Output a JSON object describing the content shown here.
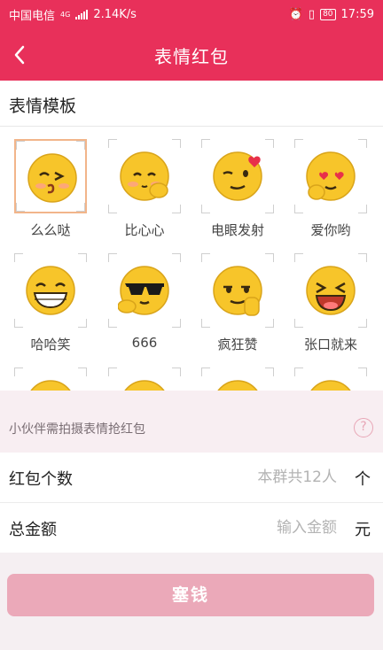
{
  "status_bar": {
    "carrier": "中国电信",
    "network_type": "4G",
    "speed": "2.14K/s",
    "battery": "80",
    "time": "17:59"
  },
  "nav": {
    "title": "表情红包"
  },
  "template_section": {
    "title": "表情模板"
  },
  "stickers": [
    {
      "label": "么么哒",
      "icon": "kissing-face-icon",
      "selected": true
    },
    {
      "label": "比心心",
      "icon": "finger-heart-face-icon",
      "selected": false
    },
    {
      "label": "电眼发射",
      "icon": "winking-face-icon",
      "selected": false
    },
    {
      "label": "爱你哟",
      "icon": "heart-eyes-face-icon",
      "selected": false
    },
    {
      "label": "哈哈笑",
      "icon": "grinning-face-icon",
      "selected": false
    },
    {
      "label": "666",
      "icon": "sunglasses-face-icon",
      "selected": false
    },
    {
      "label": "疯狂赞",
      "icon": "thumbs-up-face-icon",
      "selected": false
    },
    {
      "label": "张口就来",
      "icon": "laughing-face-icon",
      "selected": false
    },
    {
      "label": "",
      "icon": "smiling-face-icon",
      "selected": false
    },
    {
      "label": "",
      "icon": "smiling-face-icon",
      "selected": false
    },
    {
      "label": "",
      "icon": "smiling-face-icon",
      "selected": false
    },
    {
      "label": "",
      "icon": "smiling-face-icon",
      "selected": false
    }
  ],
  "hint": {
    "text": "小伙伴需拍摄表情抢红包"
  },
  "count_row": {
    "label": "红包个数",
    "placeholder": "本群共12人",
    "unit": "个"
  },
  "amount_row": {
    "label": "总金额",
    "placeholder": "输入金额",
    "unit": "元"
  },
  "submit": {
    "label": "塞钱"
  },
  "colors": {
    "brand": "#e8305a",
    "button": "#eba9b9",
    "face": "#f7c52a"
  }
}
